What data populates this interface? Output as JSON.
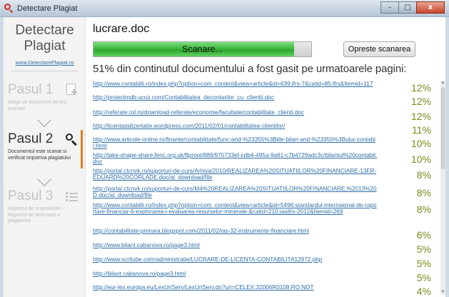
{
  "window": {
    "title": "Detectare Plagiat",
    "min": "–",
    "max": "□",
    "close": "x"
  },
  "sidebar": {
    "brand_title": "Detectare Plagiat",
    "brand_link": "www.DetectarePlagiat.ro",
    "steps": [
      {
        "title": "Pasul 1",
        "desc": "Alege un document pentru scanare",
        "icon": "add-document-icon",
        "state": "inactive"
      },
      {
        "title": "Pasul 2",
        "desc": "Documentul este scanat si verificat impotriva plagiatului",
        "icon": "magnifier-icon",
        "state": "active"
      },
      {
        "title": "Pasul 3",
        "desc": "Raportul de originalitate - Raportul de detectare a plagiatului",
        "icon": "list-icon",
        "state": "inactive"
      }
    ]
  },
  "main": {
    "file_name": "lucrare.doc",
    "progress_label": "Scanare...",
    "progress_value": 0.92,
    "stop_button": "Opreste scanarea",
    "summary": "51% din continutul documentului a fost gasit pe urmatoarele pagini:"
  },
  "results": [
    {
      "url": "http://www.contabilii.ro/index.php?option=com_content&view=article&id=639:ifrs-7&catid=85:ifrs&Itemid=117",
      "pct": "12%"
    },
    {
      "url": "http://proiectmdb.ucoz.com/Contabilitatea_decontarilor_cu_clientii.doc",
      "pct": "12%"
    },
    {
      "url": "http://referate.rol.ro/download-referate/economie/facultate/contabilitate_clienti.doc",
      "pct": "12%"
    },
    {
      "url": "http://licentasidizertatie.wordpress.com/2011/02/01/contabilitatea-clientilor/",
      "pct": "11%"
    },
    {
      "url": "http://www.articole-online.ro/finante/contabilitate/func-and-%23355%3Biile-bilan-and-%23355%3Bului-contabil.html",
      "pct": "10%"
    },
    {
      "url": "http://take-shape-share.fenc.org.uk/ftproot/886/975733ef-cdb4-495a-9a61-c7b4729adc3c/bilantul%20contabil.doc",
      "pct": "10%"
    },
    {
      "url": "http://portal.ctcnvk.ro/suporturi-de-curs/Arhiva/2010/REALIZAREA%20SITUATIILOR%20FINANCIARE-13FR-EDUARD%20CORLADE.doc/at_download/file",
      "pct": "8%"
    },
    {
      "url": "http://portal.ctcnvk.ro/suporturi-de-curs/M4%20REALIZAREA%20SITUATIILOR%20FINANCIARE,%2013%20D.doc/at_download/file",
      "pct": "8%"
    },
    {
      "url": "http://www.contabilii.ro/index.php?option=com_content&view=article&id=5496:standardul-internaional-de-raportare-financiar-6-explorarea-i-evaluarea-resurselor-minerale-&catid=210:iasifrs-2012&Itemid=269",
      "pct": "8%"
    },
    {
      "url": "http://contabilitate-primara.blogspot.com/2011/02/ias-32-instrumente-financiare.html",
      "pct": "6%"
    },
    {
      "url": "http://www.bilant.cabanova.ro/page3.html",
      "pct": "5%"
    },
    {
      "url": "http://www.scritube.com/administratie/LUCRARE-DE-LICENTA-CONTABILITA12972.php",
      "pct": "5%"
    },
    {
      "url": "http://bilant.cabanova.ro/page3.html",
      "pct": "5%"
    },
    {
      "url": "http://eur-lex.europa.eu/LexUriServ/LexUriServ.do?uri=CELEX:32006R0108:RO:NOT",
      "pct": "4%"
    }
  ]
}
